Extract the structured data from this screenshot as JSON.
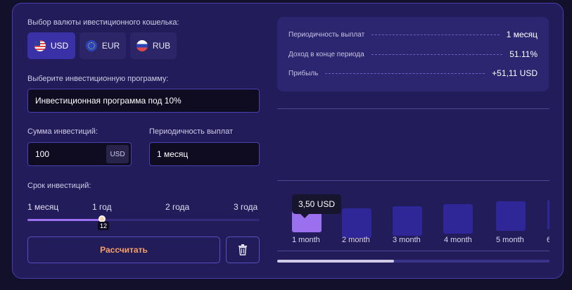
{
  "wallet": {
    "label": "Выбор валюты ивестиционного кошелька:",
    "currencies": [
      {
        "code": "USD",
        "flag": "us-flag-icon",
        "selected": true
      },
      {
        "code": "EUR",
        "flag": "eu-flag-icon",
        "selected": false
      },
      {
        "code": "RUB",
        "flag": "ru-flag-icon",
        "selected": false
      }
    ]
  },
  "program": {
    "label": "Выберите инвестиционную программу:",
    "value": "Инвестиционная программа под 10%"
  },
  "amount": {
    "label": "Сумма инвестиций:",
    "value": "100",
    "unit": "USD"
  },
  "payout": {
    "label": "Периодичность выплат",
    "value": "1 месяц"
  },
  "term": {
    "label": "Срок инвестиций:",
    "ticks": [
      "1 месяц",
      "1 год",
      "2 года",
      "3 года"
    ],
    "slider_value": "12",
    "slider_fraction": 0.32
  },
  "actions": {
    "calculate": "Рассчитать",
    "delete_icon": "trash-icon"
  },
  "summary": {
    "rows": [
      {
        "key": "Периодичность выплат",
        "value": "1 месяц"
      },
      {
        "key": "Доход в конце периода",
        "value": "51.11%"
      },
      {
        "key": "Прибыль",
        "value": "+51,11 USD"
      }
    ]
  },
  "chart": {
    "tooltip": "3,50 USD",
    "labels": [
      "1 month",
      "2 month",
      "3 month",
      "4 month",
      "5 month",
      "6"
    ],
    "active_index": 0,
    "scroll_fraction": 0.43
  },
  "colors": {
    "accent": "#9a70ee",
    "calc_text": "#f5a064",
    "card": "#231c5a"
  }
}
